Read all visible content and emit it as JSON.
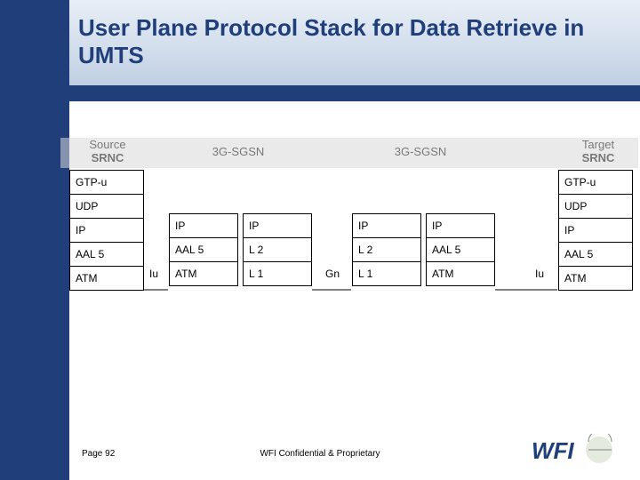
{
  "title": "User Plane Protocol Stack for Data Retrieve in UMTS",
  "nodes": {
    "src_srnc_line1": "Source",
    "src_srnc_line2": "SRNC",
    "sgsn1": "3G-SGSN",
    "sgsn2": "3G-SGSN",
    "tgt_srnc_line1": "Target",
    "tgt_srnc_line2": "SRNC"
  },
  "stacks": {
    "src": [
      "GTP-u",
      "UDP",
      "IP",
      "AAL 5",
      "ATM"
    ],
    "s1_left": [
      "IP",
      "AAL 5",
      "ATM"
    ],
    "s1_right": [
      "IP",
      "L 2",
      "L 1"
    ],
    "s2_left": [
      "IP",
      "L 2",
      "L 1"
    ],
    "s2_right": [
      "IP",
      "AAL 5",
      "ATM"
    ],
    "tgt": [
      "GTP-u",
      "UDP",
      "IP",
      "AAL 5",
      "ATM"
    ]
  },
  "interfaces": {
    "iu1": "Iu",
    "gn": "Gn",
    "iu2": "Iu"
  },
  "footer": {
    "page": "Page 92",
    "conf": "WFI Confidential & Proprietary"
  },
  "logo": {
    "text": "WFI"
  }
}
